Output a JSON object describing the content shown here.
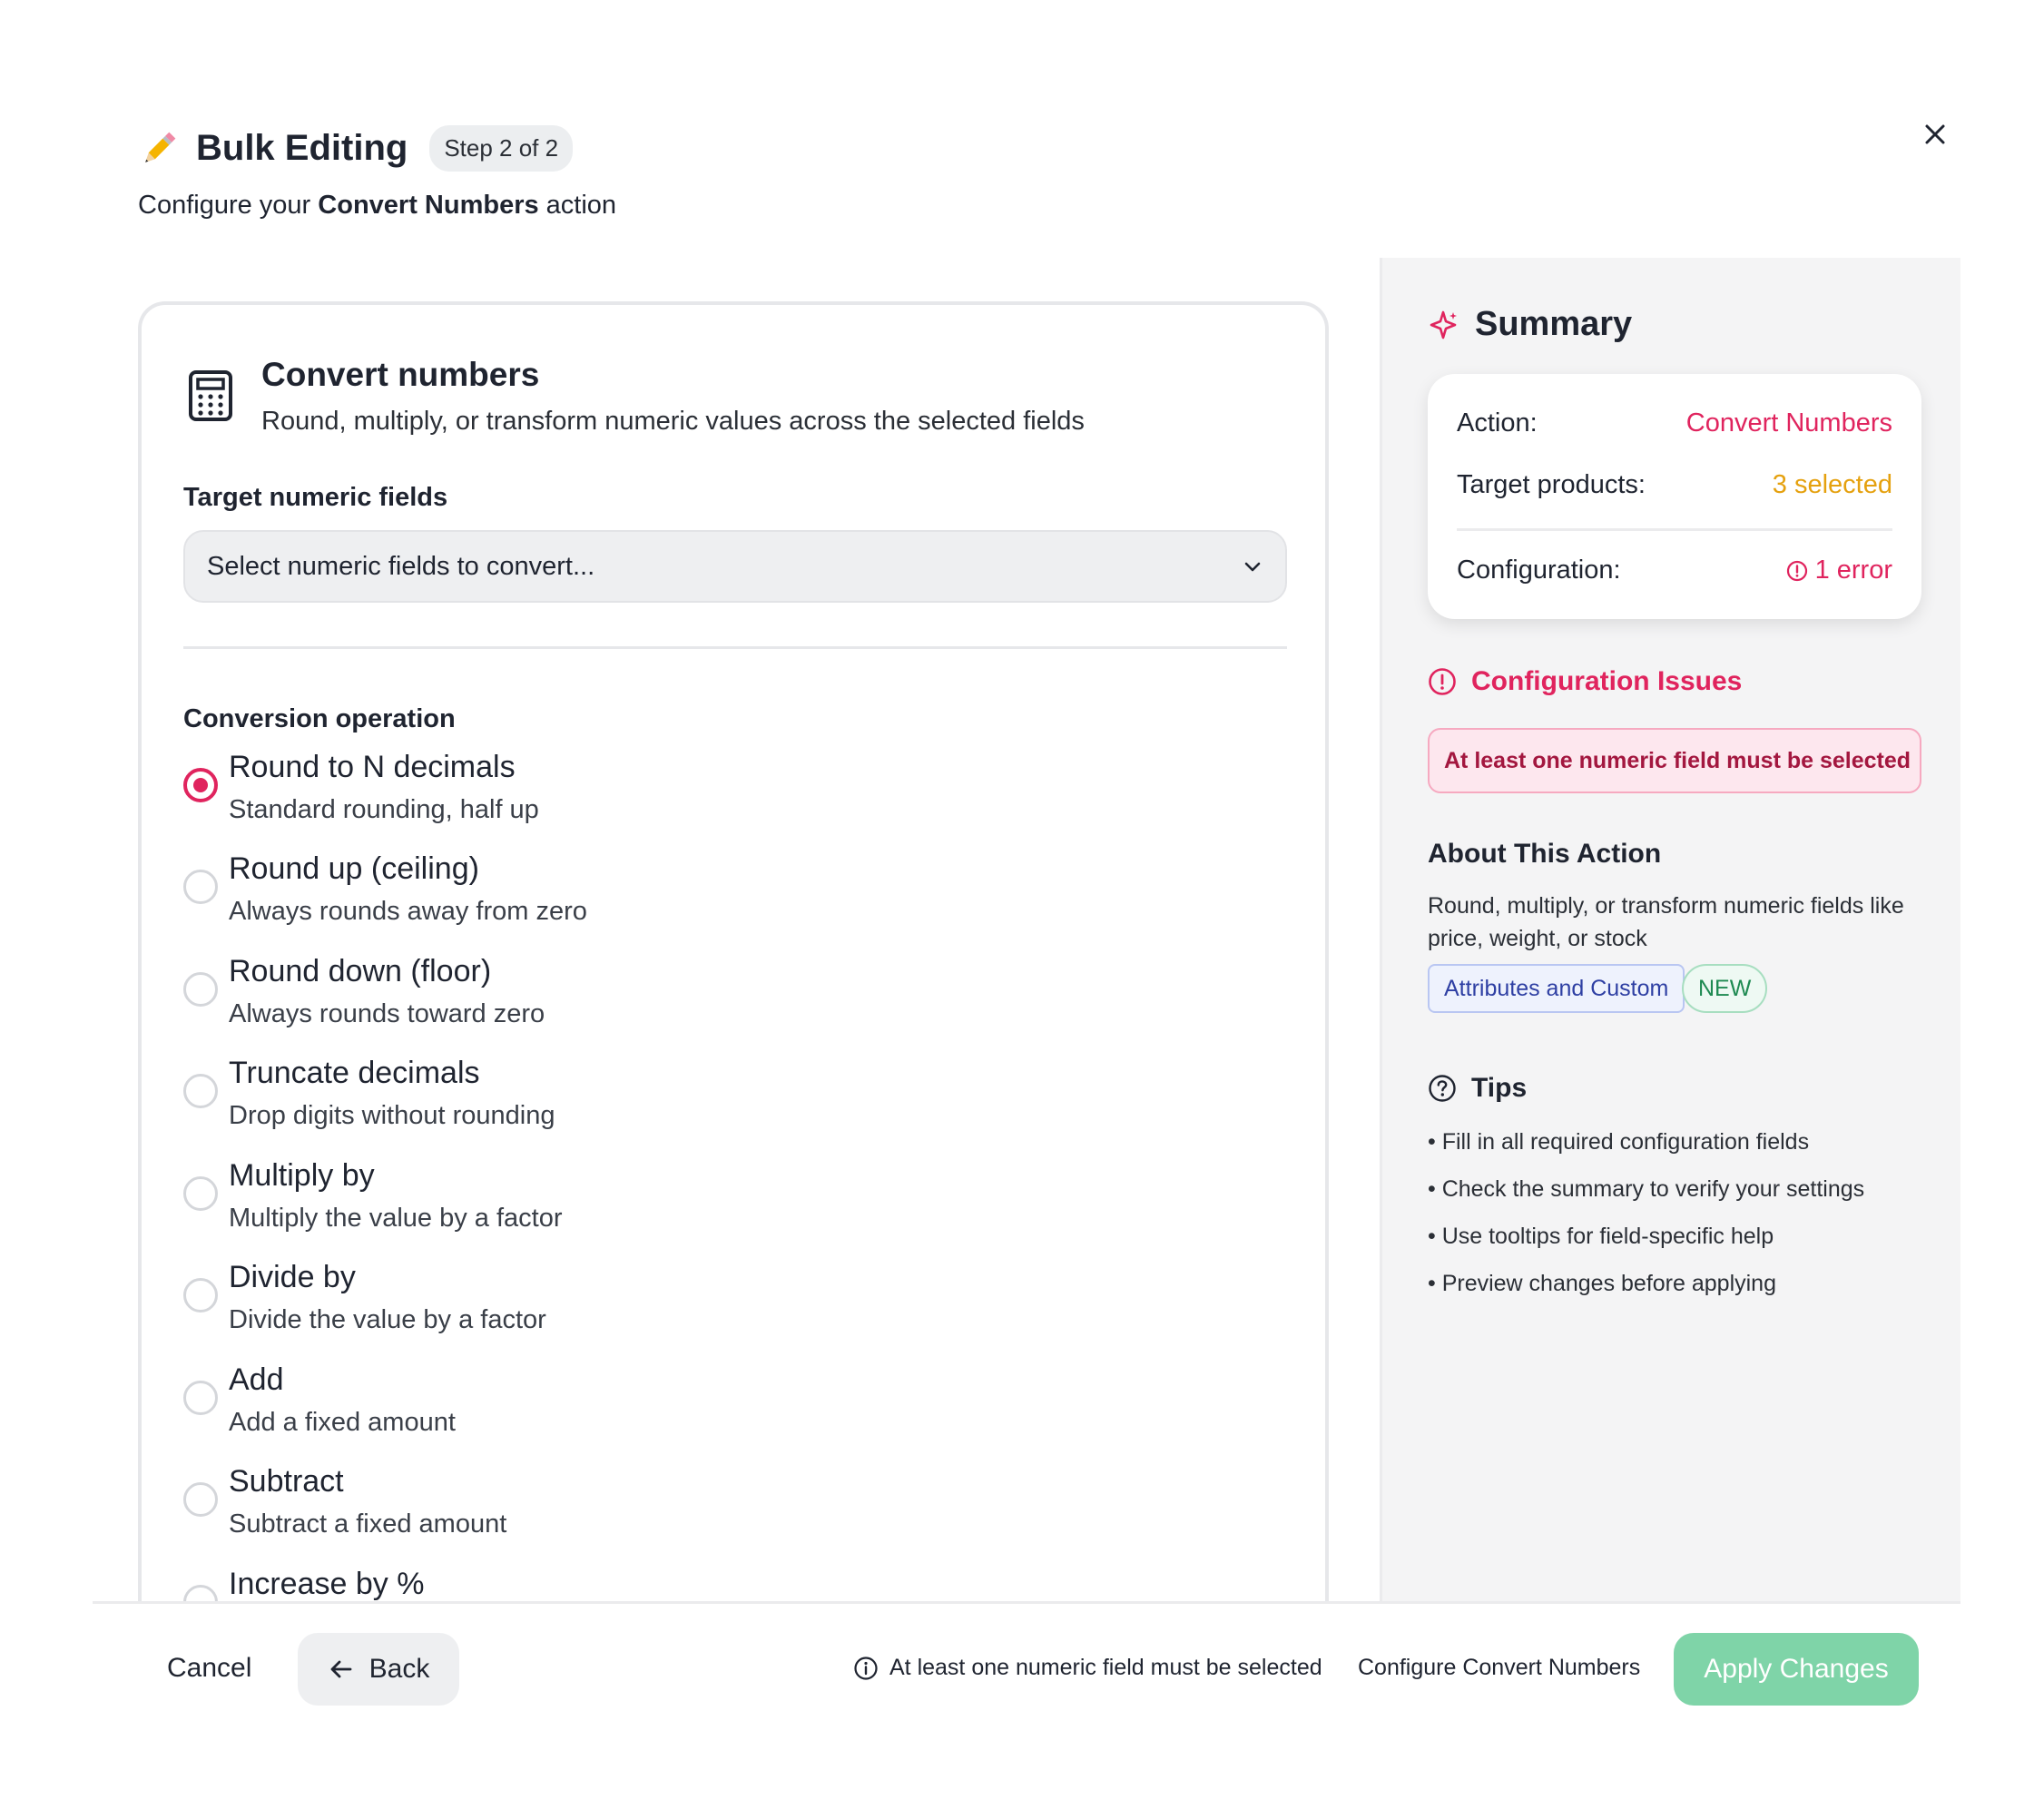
{
  "header": {
    "icon": "pencil-icon",
    "title": "Bulk Editing",
    "step": "Step 2 of 2",
    "subtitle_prefix": "Configure your ",
    "subtitle_action": "Convert Numbers",
    "subtitle_suffix": " action"
  },
  "card": {
    "title": "Convert numbers",
    "subtitle": "Round, multiply, or transform numeric values across the selected fields",
    "fields_label": "Target numeric fields",
    "fields_placeholder": "Select numeric fields to convert...",
    "operation_label": "Conversion operation",
    "options": [
      {
        "title": "Round to N decimals",
        "desc": "Standard rounding, half up",
        "selected": true
      },
      {
        "title": "Round up (ceiling)",
        "desc": "Always rounds away from zero",
        "selected": false
      },
      {
        "title": "Round down (floor)",
        "desc": "Always rounds toward zero",
        "selected": false
      },
      {
        "title": "Truncate decimals",
        "desc": "Drop digits without rounding",
        "selected": false
      },
      {
        "title": "Multiply by",
        "desc": "Multiply the value by a factor",
        "selected": false
      },
      {
        "title": "Divide by",
        "desc": "Divide the value by a factor",
        "selected": false
      },
      {
        "title": "Add",
        "desc": "Add a fixed amount",
        "selected": false
      },
      {
        "title": "Subtract",
        "desc": "Subtract a fixed amount",
        "selected": false
      },
      {
        "title": "Increase by %",
        "desc": "",
        "selected": false
      }
    ]
  },
  "summary": {
    "title": "Summary",
    "action_label": "Action:",
    "action_value": "Convert Numbers",
    "target_label": "Target products:",
    "target_value": "3 selected",
    "config_label": "Configuration:",
    "config_value": "1 error",
    "issues_title": "Configuration Issues",
    "issue_text": "At least one numeric field must be selected",
    "about_title": "About This Action",
    "about_text": "Round, multiply, or transform numeric fields like price, weight, or stock",
    "tag_scope": "Attributes and Custom",
    "tag_new": "NEW",
    "tips_title": "Tips",
    "tips": [
      "• Fill in all required configuration fields",
      "• Check the summary to verify your settings",
      "• Use tooltips for field-specific help",
      "• Preview changes before applying"
    ]
  },
  "footer": {
    "cancel": "Cancel",
    "back": "Back",
    "message": "At least one numeric field must be selected",
    "configure": "Configure Convert Numbers",
    "apply": "Apply Changes"
  },
  "colors": {
    "accent": "#e0245e",
    "warning": "#e5a10f",
    "apply_disabled": "#7fd4a8"
  }
}
